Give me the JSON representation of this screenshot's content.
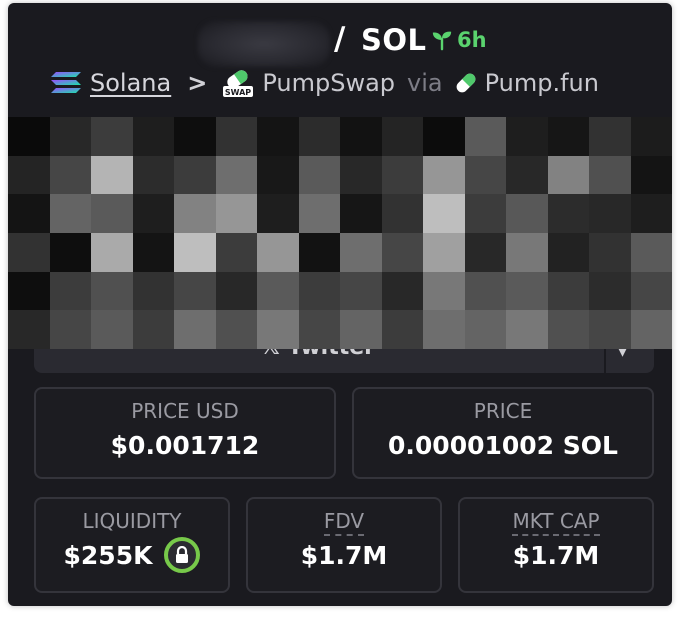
{
  "header": {
    "separator": "/",
    "quote_symbol": "SOL",
    "age": "6h",
    "age_color": "#5ad36e",
    "chain": "Solana",
    "breadcrumb_separator": ">",
    "dex": "PumpSwap",
    "dex_badge": "SWAP",
    "via_label": "via",
    "launchpad": "Pump.fun"
  },
  "social": {
    "label": "Twitter",
    "icon": "x-icon"
  },
  "stats": {
    "price_usd": {
      "label": "PRICE USD",
      "value": "$0.001712"
    },
    "price_native": {
      "label": "PRICE",
      "value": "0.00001002 SOL"
    },
    "liquidity": {
      "label": "LIQUIDITY",
      "value": "$255K",
      "icon": "lock-icon",
      "icon_color": "#77c94a"
    },
    "fdv": {
      "label": "FDV",
      "value": "$1.7M"
    },
    "mkt_cap": {
      "label": "MKT CAP",
      "value": "$1.7M"
    }
  }
}
